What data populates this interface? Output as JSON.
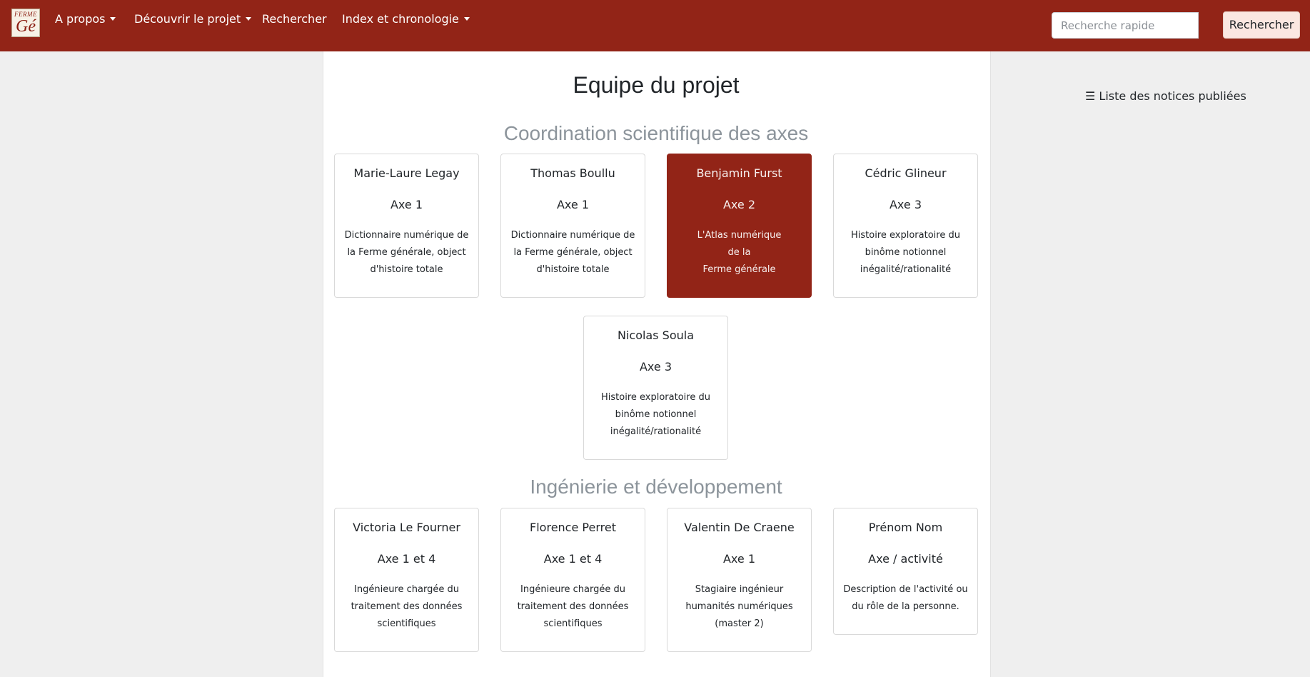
{
  "navbar": {
    "logo": {
      "line1": "FERME",
      "line2": "Gé"
    },
    "items": [
      {
        "label": "A propos",
        "dropdown": true
      },
      {
        "label": "Découvrir le projet",
        "dropdown": true
      },
      {
        "label": "Rechercher",
        "dropdown": false
      },
      {
        "label": "Index et chronologie",
        "dropdown": true
      }
    ],
    "search": {
      "placeholder": "Recherche rapide",
      "value": "",
      "button_label": "Rechercher"
    }
  },
  "page": {
    "title": "Equipe du projet",
    "sidebar_link": "☰ Liste des notices publiées"
  },
  "sections": [
    {
      "title": "Coordination scientifique des axes",
      "members": [
        {
          "name": "Marie-Laure Legay",
          "axis": "Axe 1",
          "description": "Dictionnaire numérique de\nla Ferme générale, object\nd'histoire totale"
        },
        {
          "name": "Thomas Boullu",
          "axis": "Axe 1",
          "description": "Dictionnaire numérique de\nla Ferme générale, object\nd'histoire totale"
        },
        {
          "name": "Benjamin Furst",
          "axis": "Axe 2",
          "description": "L'Atlas numérique\nde la\nFerme générale",
          "highlighted": true
        },
        {
          "name": "Cédric Glineur",
          "axis": "Axe 3",
          "description": "Histoire exploratoire du\nbinôme notionnel\ninégalité/rationalité"
        },
        {
          "name": "Nicolas Soula",
          "axis": "Axe 3",
          "description": "Histoire exploratoire du\nbinôme notionnel\ninégalité/rationalité"
        }
      ]
    },
    {
      "title": "Ingénierie et développement",
      "members": [
        {
          "name": "Victoria Le Fourner",
          "axis": "Axe 1 et 4",
          "description": "Ingénieure chargée du\ntraitement des données\nscientifiques"
        },
        {
          "name": "Florence Perret",
          "axis": "Axe 1 et 4",
          "description": "Ingénieure chargée du\ntraitement des données\nscientifiques"
        },
        {
          "name": "Valentin De Craene",
          "axis": "Axe 1",
          "description": "Stagiaire ingénieur\nhumanités numériques\n(master 2)"
        },
        {
          "name": "Prénom Nom",
          "axis": "Axe / activité",
          "description": "Description de l'activité ou\ndu rôle de la personne."
        }
      ]
    }
  ],
  "colors": {
    "navbar_bg": "#922417",
    "highlight_card_bg": "#922417",
    "section_title": "#8c949b",
    "page_bg": "#efefef"
  },
  "icons": {
    "menu": "hamburger-icon",
    "dropdown": "caret-down-icon"
  }
}
